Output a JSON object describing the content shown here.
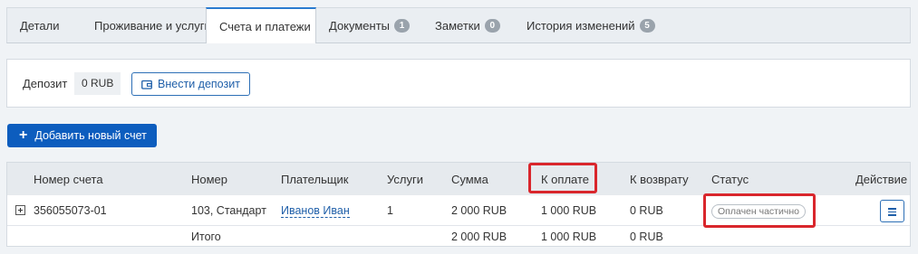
{
  "tabs": [
    {
      "label": "Детали",
      "badge": null
    },
    {
      "label": "Проживание и услуги",
      "badge": null
    },
    {
      "label": "Счета и платежи",
      "badge": null
    },
    {
      "label": "Документы",
      "badge": "1"
    },
    {
      "label": "Заметки",
      "badge": "0"
    },
    {
      "label": "История изменений",
      "badge": "5"
    }
  ],
  "deposit": {
    "label": "Депозит",
    "value": "0 RUB",
    "button_label": "Внести депозит"
  },
  "add_invoice_button": "Добавить новый счет",
  "table": {
    "headers": {
      "number": "Номер счета",
      "room": "Номер",
      "payer": "Плательщик",
      "services": "Услуги",
      "sum": "Сумма",
      "to_pay": "К оплате",
      "refund": "К возврату",
      "status": "Статус",
      "action": "Действие"
    },
    "rows": [
      {
        "number": "356055073-01",
        "room": "103, Стандарт",
        "payer": "Иванов Иван",
        "services": "1",
        "sum": "2 000 RUB",
        "to_pay": "1 000 RUB",
        "refund": "0 RUB",
        "status": "Оплачен частично"
      }
    ],
    "total": {
      "label": "Итого",
      "sum": "2 000 RUB",
      "to_pay": "1 000 RUB",
      "refund": "0 RUB"
    }
  },
  "colors": {
    "accent": "#0d5dbe",
    "highlight": "#d9262c",
    "badge": "#9aa3ac"
  },
  "icons": [
    "wallet-icon",
    "plus-icon",
    "expand-plus-icon",
    "hamburger-menu-icon"
  ]
}
